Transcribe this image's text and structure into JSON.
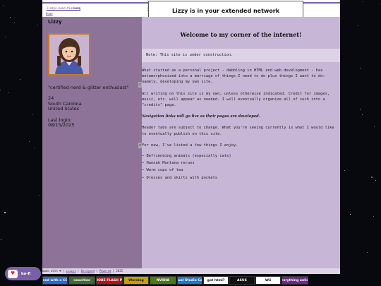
{
  "top": {
    "links_left": [
      "lizzys.neocities.org",
      "Home"
    ],
    "links_mid": [
      "Blog",
      "Contact"
    ],
    "tiny_link": "Home",
    "network_label": "Lizzy is in your extended network"
  },
  "sidebar": {
    "name": "Lizzy",
    "quote": "\"certified nerd & glitter enthusiast\"",
    "age": "24",
    "state": "South Carolina",
    "country": "United States",
    "login_label": "Last login:",
    "login_date": "08/15/2025"
  },
  "main": {
    "heading": "Welcome to my corner of the internet!",
    "note": "Note: This site is under construction.",
    "paragraphs": [
      "What started as a personal project - dabbling in HTML and web development - has metamorphosized into a marriage of things I need to do plus things I want to do: namely, developing my own site.",
      "All writing on this site is my own, unless otherwise indicated. Credit for images, music, etc. will appear as needed. I will eventually organize all of such into a \"credits\" page."
    ],
    "nav_note": "Navigation links will go live as their pages are developed.",
    "paragraphs2": [
      "Header tabs are subject to change. What you're seeing currently is what I would like to eventually publish on this site.",
      "For now, I've listed a few things I enjoy."
    ],
    "likes": [
      "Befriending animals (especially cats)",
      "Hannah Montana reruns",
      "Warm cups of tea",
      "Dresses and skirts with pockets"
    ]
  },
  "footer": {
    "made_with": "made with ♥",
    "links": [
      "Lizzys",
      "Designed",
      "Powered"
    ],
    "year": "2025"
  },
  "badges": [
    {
      "label": "Best viewed with a COMPUTER",
      "color": "#2a6ad0"
    },
    {
      "label": "neocities",
      "color": "#3d6b2e"
    },
    {
      "label": "Get ADOBE FLASH PLAYER",
      "color": "#b51212"
    },
    {
      "label": "Warning",
      "color": "#c8a000"
    },
    {
      "label": "NVIDIA",
      "color": "#4a7a10"
    },
    {
      "label": "Visual Studio Code",
      "color": "#1f78d0"
    },
    {
      "label": "got html?",
      "color": "#ffffff"
    },
    {
      "label": "ASUS",
      "color": "#111111"
    },
    {
      "label": "Wii",
      "color": "#ffffff"
    },
    {
      "label": "everything online",
      "color": "#6a2a8a"
    }
  ],
  "kofi": {
    "label": "ko-fi"
  }
}
